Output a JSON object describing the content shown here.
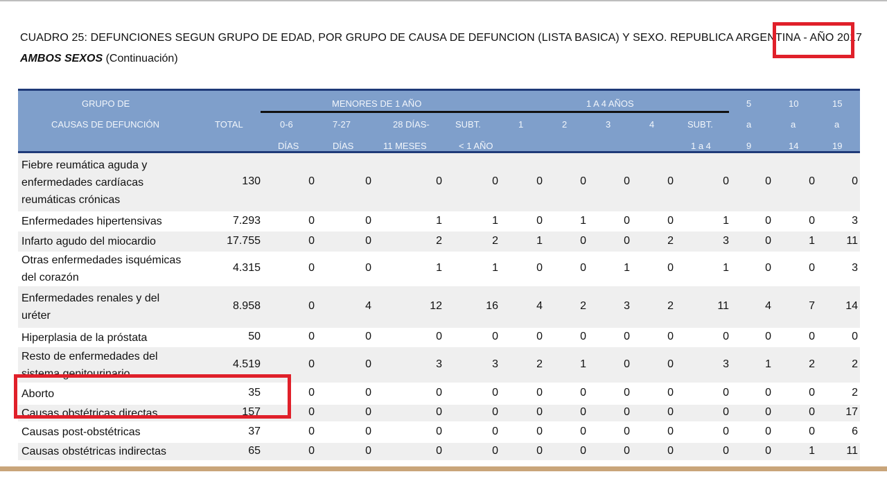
{
  "document": {
    "title": "CUADRO 25: DEFUNCIONES SEGUN GRUPO DE EDAD,  POR GRUPO DE CAUSA DE DEFUNCION (LISTA BASICA) Y SEXO.  REPUBLICA ARGENTINA - AÑO 2017",
    "subtitle_bold": "AMBOS SEXOS",
    "subtitle_rest": "  (Continuación)"
  },
  "header": {
    "grupo_de": "GRUPO DE",
    "causas": "CAUSAS DE DEFUNCIÓN",
    "total": "TOTAL",
    "menores": "MENORES DE 1 AÑO",
    "uno_a_cuatro": "1 A 4 AÑOS",
    "c06a": "0-6",
    "c06b": "DÍAS",
    "c727a": "7-27",
    "c727b": "DÍAS",
    "c28a": "28 DÍAS-",
    "c28b": "11 MESES",
    "subt1a": "SUBT.",
    "subt1b": "< 1 AÑO",
    "a1": "1",
    "a2": "2",
    "a3": "3",
    "a4": "4",
    "subt4a": "SUBT.",
    "subt4b": "1 a 4",
    "g5a": "5",
    "g5b": "a",
    "g5c": "9",
    "g10a": "10",
    "g10b": "a",
    "g10c": "14",
    "g15a": "15",
    "g15b": "a",
    "g15c": "19"
  },
  "rows": [
    {
      "cause": [
        "Fiebre reumática aguda y",
        "enfermedades cardíacas",
        "reumáticas crónicas"
      ],
      "values": [
        "130",
        "0",
        "0",
        "0",
        "0",
        "0",
        "0",
        "0",
        "0",
        "0",
        "0",
        "0",
        "0"
      ]
    },
    {
      "cause": [
        "Enfermedades hipertensivas"
      ],
      "values": [
        "7.293",
        "0",
        "0",
        "1",
        "1",
        "0",
        "1",
        "0",
        "0",
        "1",
        "0",
        "0",
        "3"
      ]
    },
    {
      "cause": [
        "Infarto agudo del miocardio"
      ],
      "values": [
        "17.755",
        "0",
        "0",
        "2",
        "2",
        "1",
        "0",
        "0",
        "2",
        "3",
        "0",
        "1",
        "11"
      ]
    },
    {
      "cause": [
        "Otras enfermedades isquémicas",
        "del corazón"
      ],
      "values": [
        "4.315",
        "0",
        "0",
        "1",
        "1",
        "0",
        "0",
        "1",
        "0",
        "1",
        "0",
        "0",
        "3"
      ]
    },
    {
      "cause": [
        "Enfermedades renales y del",
        "uréter"
      ],
      "values": [
        "8.958",
        "0",
        "4",
        "12",
        "16",
        "4",
        "2",
        "3",
        "2",
        "11",
        "4",
        "7",
        "14"
      ]
    },
    {
      "cause": [
        "Hiperplasia de la próstata"
      ],
      "values": [
        "50",
        "0",
        "0",
        "0",
        "0",
        "0",
        "0",
        "0",
        "0",
        "0",
        "0",
        "0",
        "0"
      ]
    },
    {
      "cause": [
        "Resto de enfermedades del",
        "sistema genitourinario"
      ],
      "values": [
        "4.519",
        "0",
        "0",
        "3",
        "3",
        "2",
        "1",
        "0",
        "0",
        "3",
        "1",
        "2",
        "2"
      ]
    },
    {
      "cause": [
        "Aborto"
      ],
      "values": [
        "35",
        "0",
        "0",
        "0",
        "0",
        "0",
        "0",
        "0",
        "0",
        "0",
        "0",
        "0",
        "2"
      ]
    },
    {
      "cause": [
        "Causas obstétricas directas"
      ],
      "values": [
        "157",
        "0",
        "0",
        "0",
        "0",
        "0",
        "0",
        "0",
        "0",
        "0",
        "0",
        "0",
        "17"
      ]
    },
    {
      "cause": [
        "Causas post-obstétricas"
      ],
      "values": [
        "37",
        "0",
        "0",
        "0",
        "0",
        "0",
        "0",
        "0",
        "0",
        "0",
        "0",
        "0",
        "6"
      ]
    },
    {
      "cause": [
        "Causas obstétricas indirectas"
      ],
      "values": [
        "65",
        "0",
        "0",
        "0",
        "0",
        "0",
        "0",
        "0",
        "0",
        "0",
        "0",
        "1",
        "11"
      ]
    }
  ]
}
